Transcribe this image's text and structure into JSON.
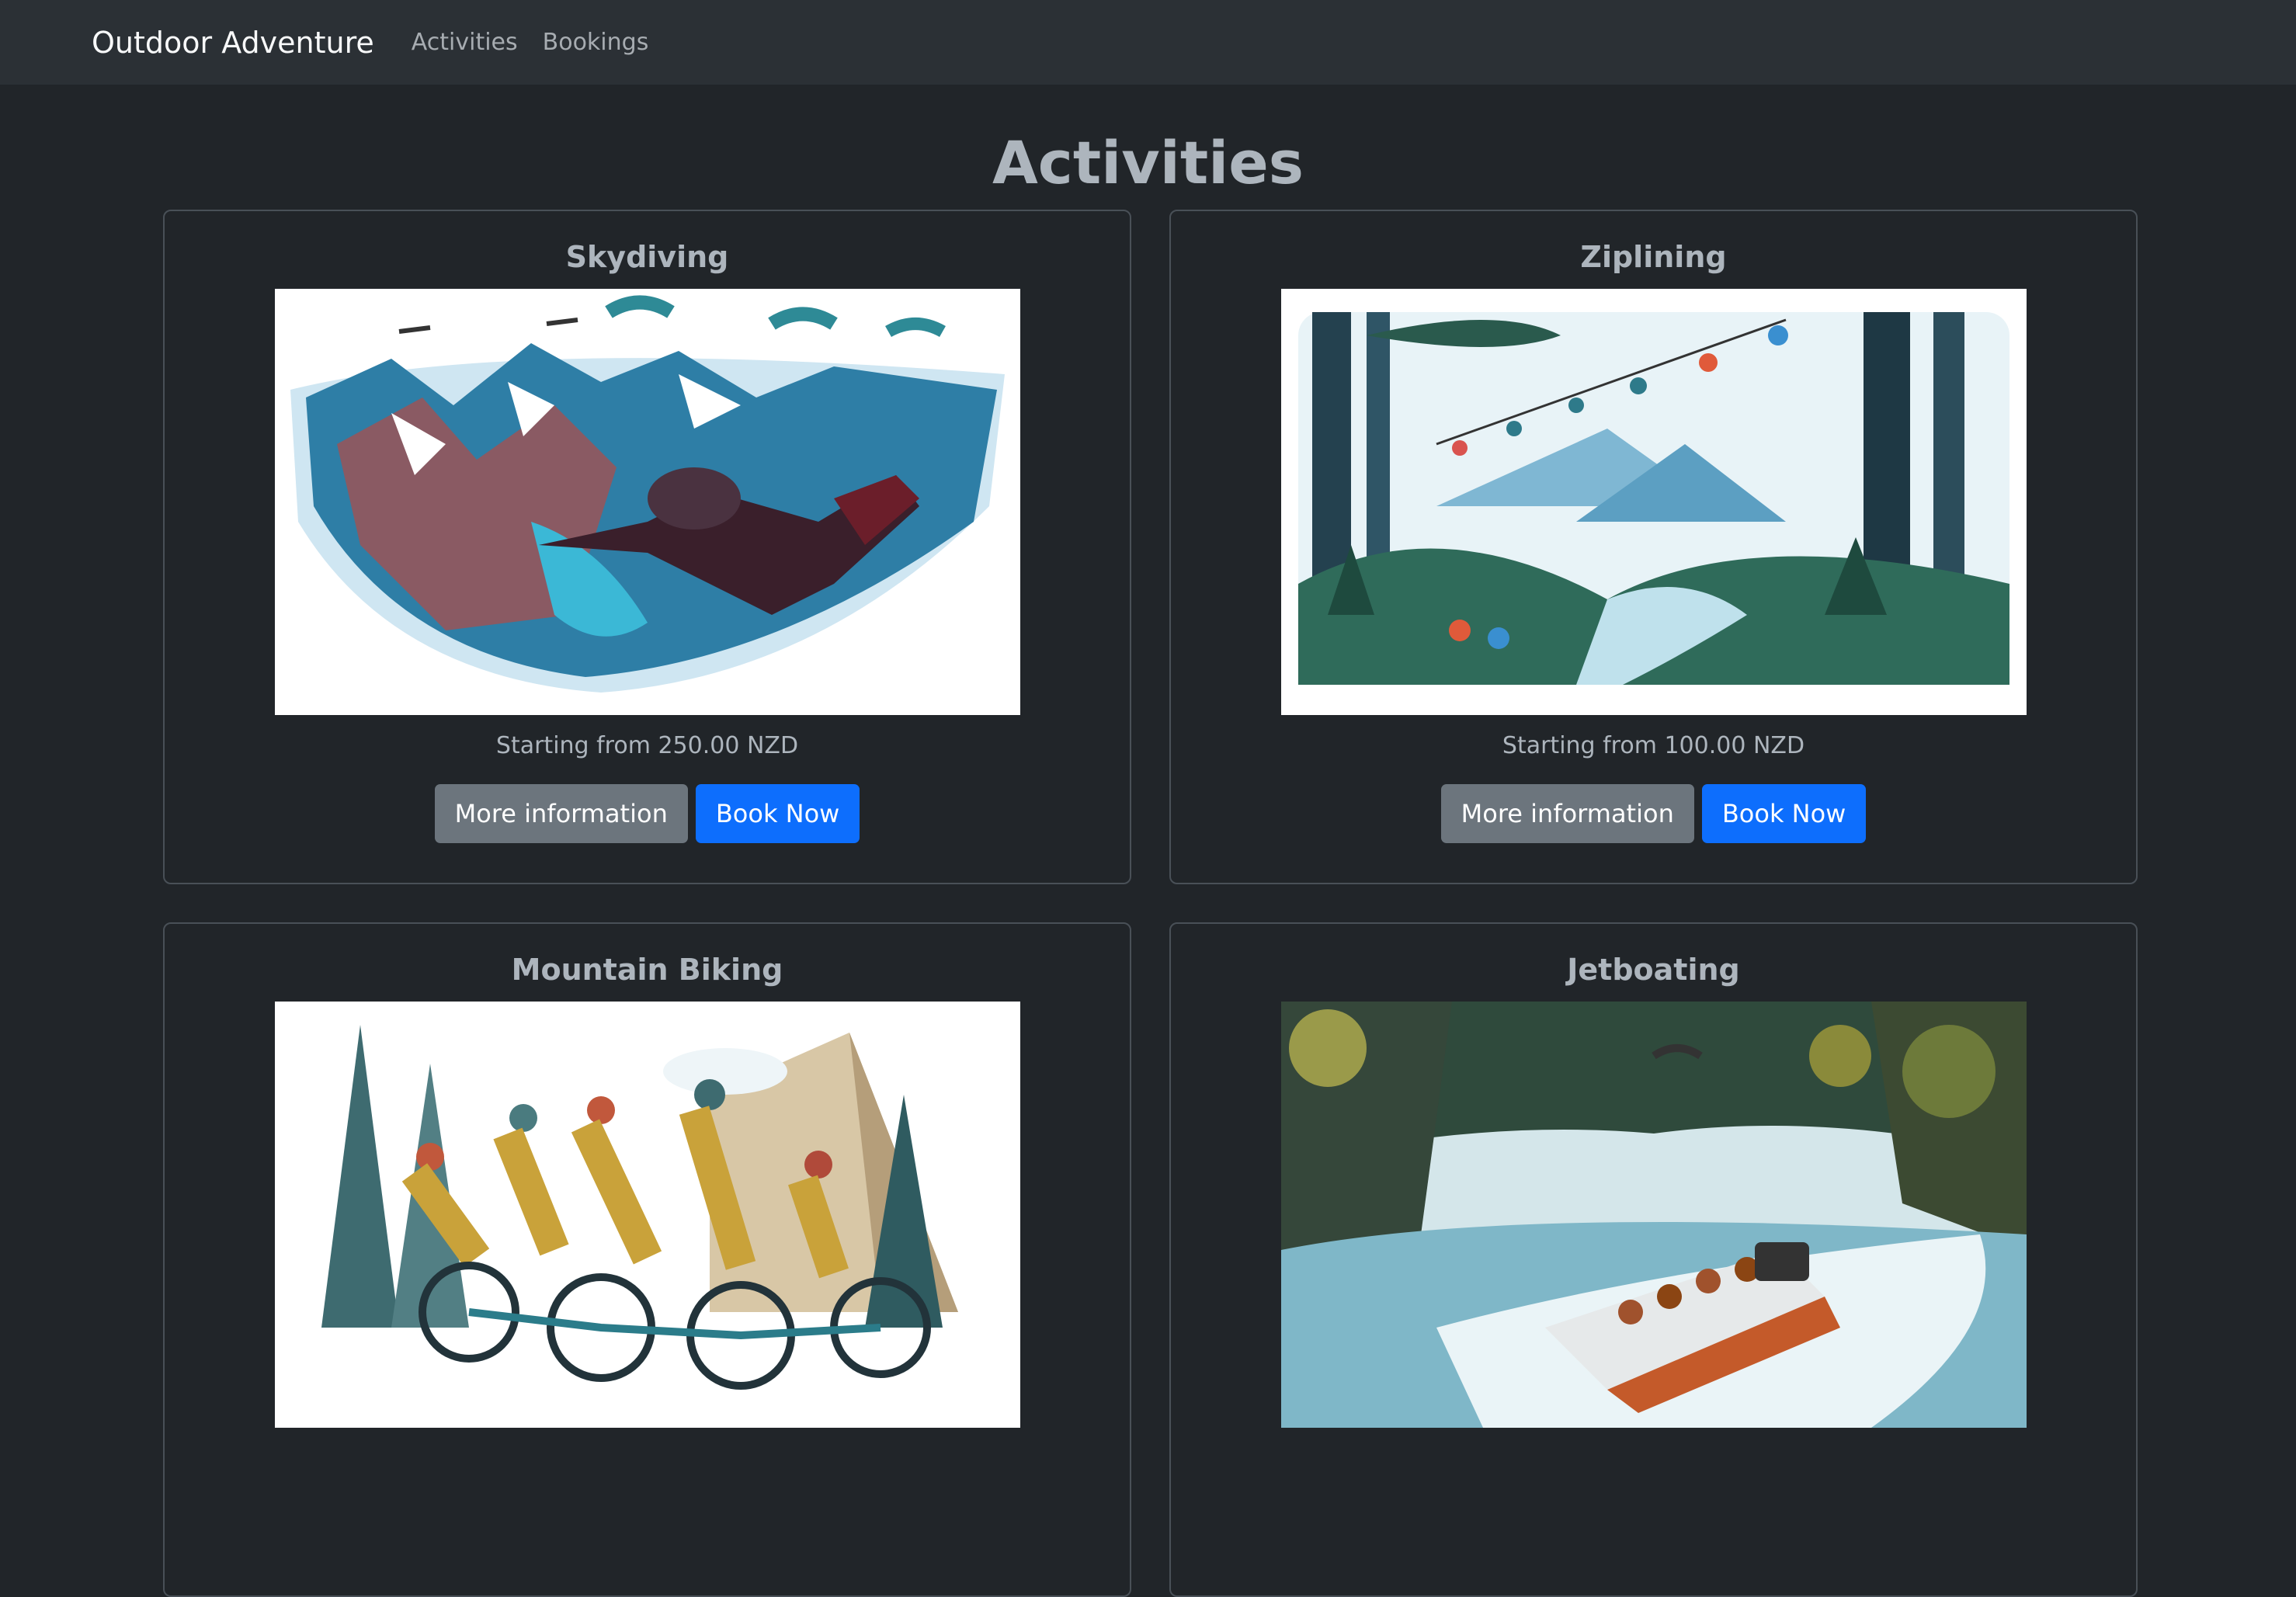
{
  "navbar": {
    "brand": "Outdoor Adventure",
    "links": [
      "Activities",
      "Bookings"
    ]
  },
  "page": {
    "title": "Activities"
  },
  "activities": [
    {
      "title": "Skydiving",
      "price": "Starting from 250.00 NZD",
      "image_icon": "skydiving-illustration"
    },
    {
      "title": "Ziplining",
      "price": "Starting from 100.00 NZD",
      "image_icon": "ziplining-illustration"
    },
    {
      "title": "Mountain Biking",
      "price": "",
      "image_icon": "mountain-biking-illustration"
    },
    {
      "title": "Jetboating",
      "price": "",
      "image_icon": "jetboating-illustration"
    }
  ],
  "buttons": {
    "more_info": "More information",
    "book_now": "Book Now"
  },
  "colors": {
    "background": "#212529",
    "navbar": "#2b3035",
    "primary": "#0d6efd",
    "secondary": "#6c757d"
  }
}
